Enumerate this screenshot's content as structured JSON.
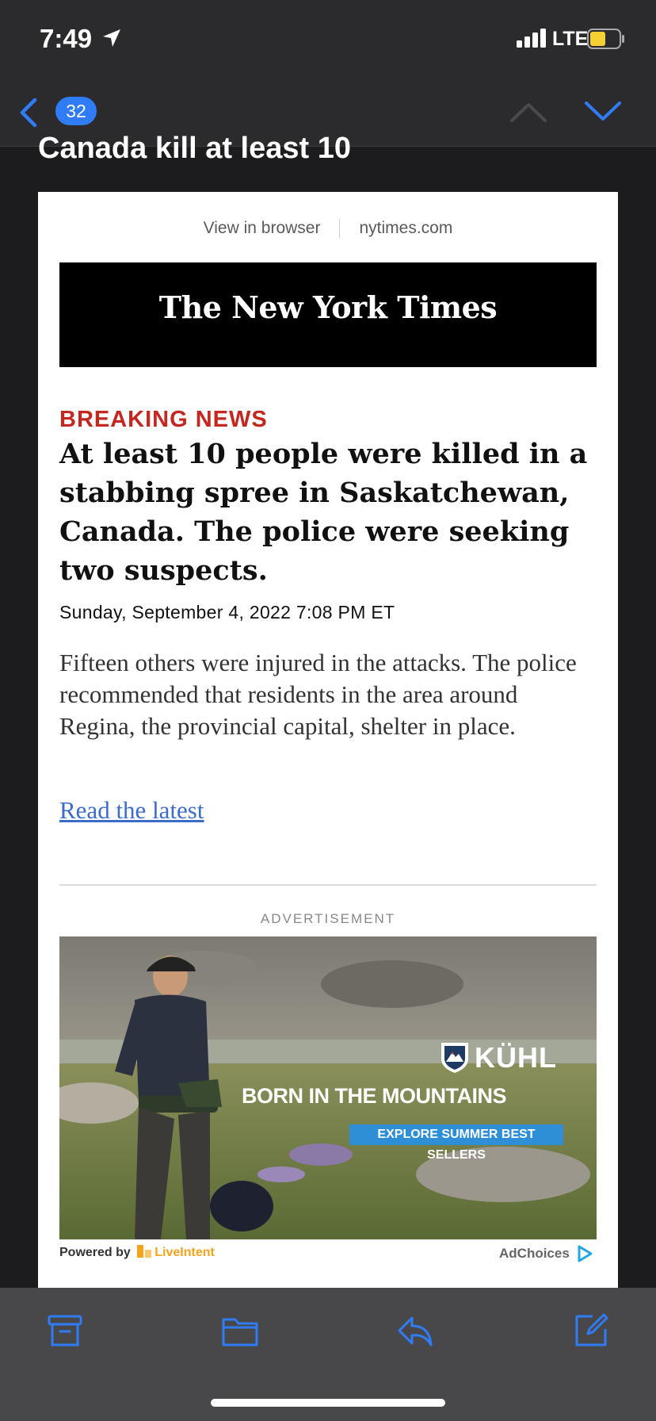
{
  "status_bar": {
    "time": "7:49",
    "network": "LTE"
  },
  "nav": {
    "unread_count": "32"
  },
  "email": {
    "subject_visible": "Canada kill at least 10",
    "view_in_browser": "View in browser",
    "site_link": "nytimes.com",
    "masthead": "The New York Times",
    "kicker": "BREAKING NEWS",
    "headline": "At least 10 people were killed in a stabbing spree in Saskatchewan, Canada. The police were seeking two suspects.",
    "dateline": "Sunday, September 4, 2022 7:08 PM ET",
    "summary": "Fifteen others were injured in the attacks. The police recommended that residents in the area around Regina, the provincial capital, shelter in place.",
    "read_link": "Read the latest"
  },
  "ad": {
    "label": "ADVERTISEMENT",
    "brand": "KÜHL",
    "tagline": "BORN IN THE MOUNTAINS",
    "cta": "EXPLORE SUMMER BEST SELLERS",
    "powered_by": "Powered by",
    "powered_brand": "LiveIntent",
    "adchoices": "AdChoices"
  },
  "colors": {
    "accent": "#2f7cf6",
    "breaking_red": "#c3271f",
    "link_blue": "#3b6ccb"
  },
  "toolbar": {
    "icons": [
      "archive-icon",
      "folder-icon",
      "reply-icon",
      "compose-icon"
    ]
  }
}
